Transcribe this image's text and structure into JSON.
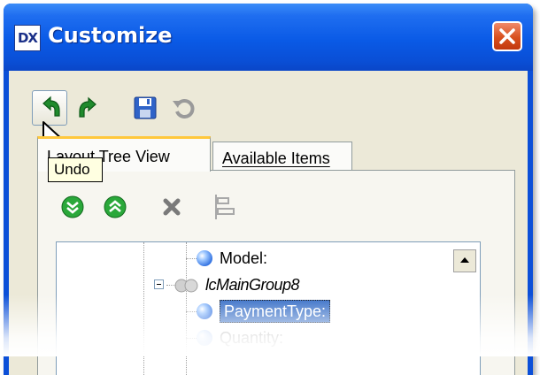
{
  "window": {
    "title": "Customize",
    "app_icon_text": "DX"
  },
  "toolbar": {
    "undo_icon": "undo-arrow-icon",
    "redo_icon": "redo-arrow-icon",
    "save_icon": "floppy-disk-icon",
    "reset_icon": "reset-icon",
    "tooltip": "Undo"
  },
  "tabs": [
    {
      "label": "Layout Tree View",
      "visible_label": "Layout Tree View",
      "selected": true
    },
    {
      "label": "Available Items",
      "selected": false
    }
  ],
  "panel_toolbar": {
    "expand_all_icon": "expand-all-icon",
    "collapse_all_icon": "collapse-all-icon",
    "delete_icon": "delete-x-icon",
    "align_icon": "align-left-icon"
  },
  "tree": {
    "items": [
      {
        "label": "Model:",
        "type": "item"
      },
      {
        "label": "lcMainGroup8",
        "type": "group",
        "expanded": true
      },
      {
        "label": "PaymentType:",
        "type": "item",
        "selected": true
      },
      {
        "label": "Quantity:",
        "type": "item"
      }
    ]
  },
  "colors": {
    "titlebar": "#0a5ae6",
    "selection": "#316ac5",
    "tab_highlight": "#ffc83c",
    "close_button": "#d8501e"
  }
}
